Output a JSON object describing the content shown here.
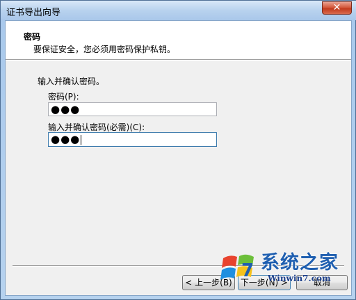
{
  "window": {
    "title": "证书导出向导",
    "close_glyph": "✕"
  },
  "header": {
    "title": "密码",
    "subtitle": "要保证安全，您必须用密码保护私钥。"
  },
  "form": {
    "instruction": "输入并确认密码。",
    "password_label": "密码(P):",
    "password_value": "●●●",
    "confirm_label": "输入并确认密码(必需)(C):",
    "confirm_value": "●●●"
  },
  "buttons": {
    "back": "< 上一步(B)",
    "next": "下一步(N) >",
    "cancel": "取消"
  },
  "watermark": {
    "brand": "系统之家",
    "url": "Winwin7.com"
  },
  "icons": {
    "logo": "win7-logo-icon"
  }
}
